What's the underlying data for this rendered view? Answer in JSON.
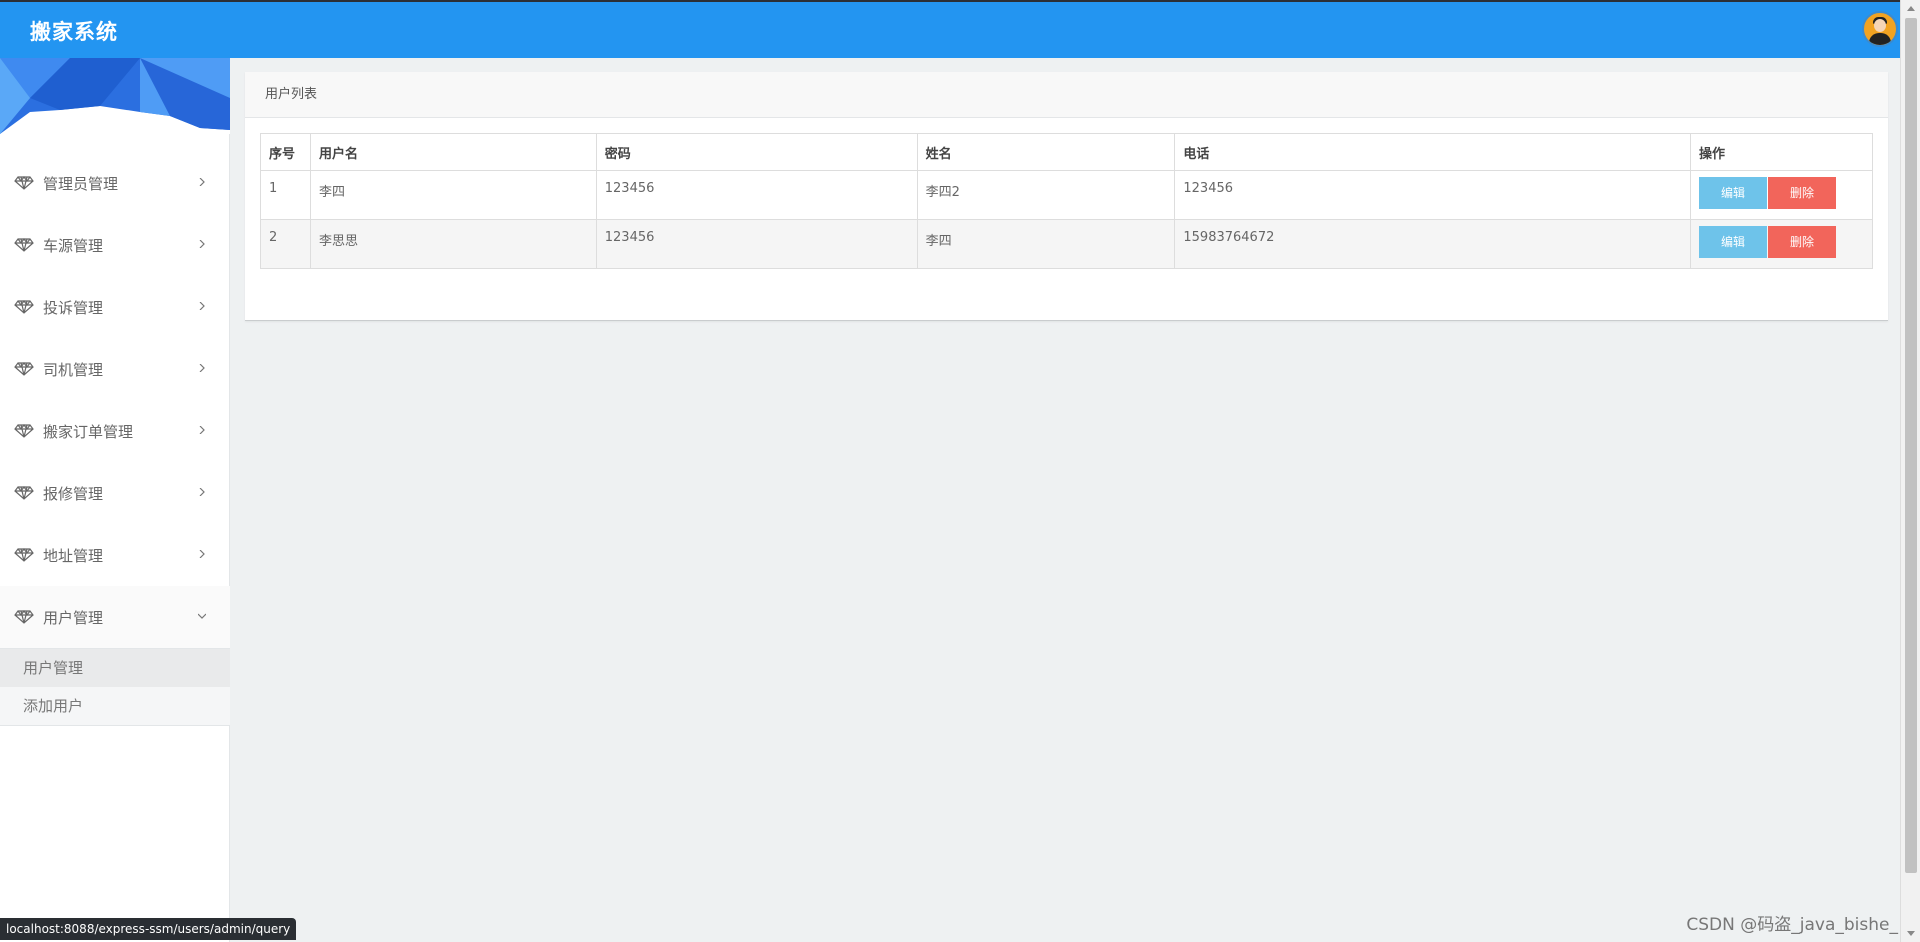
{
  "header": {
    "brand": "搬家系统",
    "avatar_icon": "user-avatar"
  },
  "colors": {
    "topbar": "#2395f1",
    "edit_button": "#6ec3ea",
    "delete_button": "#f2655b",
    "content_bg": "#eef1f2"
  },
  "sidebar": {
    "items": [
      {
        "label": "管理员管理",
        "icon": "diamond-icon"
      },
      {
        "label": "车源管理",
        "icon": "diamond-icon"
      },
      {
        "label": "投诉管理",
        "icon": "diamond-icon"
      },
      {
        "label": "司机管理",
        "icon": "diamond-icon"
      },
      {
        "label": "搬家订单管理",
        "icon": "diamond-icon"
      },
      {
        "label": "报修管理",
        "icon": "diamond-icon"
      },
      {
        "label": "地址管理",
        "icon": "diamond-icon"
      },
      {
        "label": "用户管理",
        "icon": "diamond-icon"
      }
    ],
    "submenu": [
      {
        "label": "用户管理"
      },
      {
        "label": "添加用户"
      }
    ]
  },
  "panel": {
    "title": "用户列表",
    "columns": [
      "序号",
      "用户名",
      "密码",
      "姓名",
      "电话",
      "操作"
    ],
    "rows": [
      {
        "index": "1",
        "username": "李四",
        "password": "123456",
        "name": "李四2",
        "phone": "123456"
      },
      {
        "index": "2",
        "username": "李思思",
        "password": "123456",
        "name": "李四",
        "phone": "15983764672"
      }
    ],
    "edit_label": "编辑",
    "delete_label": "删除"
  },
  "status_bar": {
    "url": "localhost:8088/express-ssm/users/admin/query"
  },
  "watermark": "CSDN @码盗_java_bishe_"
}
